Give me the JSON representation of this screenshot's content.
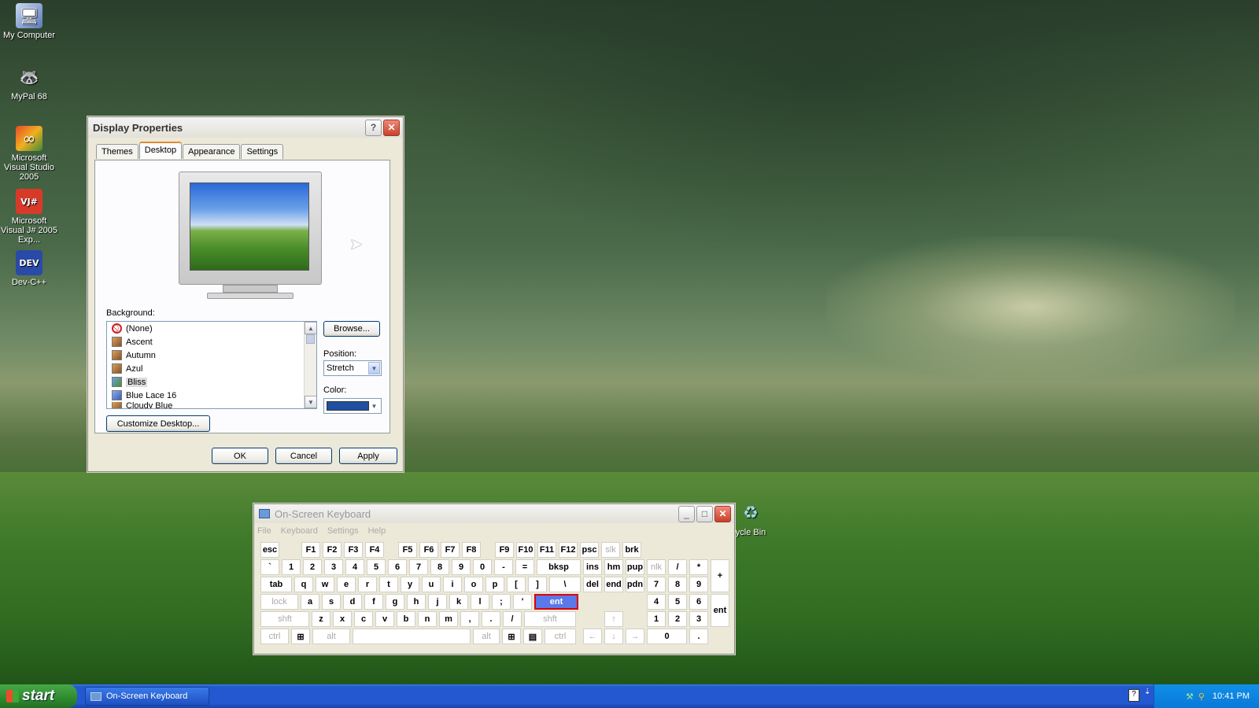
{
  "desktop": {
    "icons": [
      {
        "label": "My Computer",
        "glyph": "🖥"
      },
      {
        "label": "MyPal 68",
        "glyph": "🦝"
      },
      {
        "label": "Microsoft Visual Studio 2005",
        "glyph": "∞"
      },
      {
        "label": "Microsoft Visual J# 2005 Exp...",
        "glyph": "VJ#"
      },
      {
        "label": "Dev-C++",
        "glyph": "DEV"
      }
    ],
    "recycle_bin_label": "ycle Bin"
  },
  "display_properties": {
    "title": "Display Properties",
    "help_label": "?",
    "close_label": "✕",
    "tabs": [
      "Themes",
      "Desktop",
      "Appearance",
      "Settings"
    ],
    "active_tab": "Desktop",
    "background_label": "Background:",
    "backgrounds": [
      {
        "name": "(None)",
        "type": "none"
      },
      {
        "name": "Ascent",
        "type": "image"
      },
      {
        "name": "Autumn",
        "type": "image"
      },
      {
        "name": "Azul",
        "type": "image"
      },
      {
        "name": "Bliss",
        "type": "image",
        "selected": true
      },
      {
        "name": "Blue Lace 16",
        "type": "image"
      },
      {
        "name": "Cloudy Blue",
        "type": "image"
      }
    ],
    "browse_label": "Browse...",
    "position_label": "Position:",
    "position_value": "Stretch",
    "color_label": "Color:",
    "color_value": "#1f4ea3",
    "customize_label": "Customize Desktop...",
    "ok_label": "OK",
    "cancel_label": "Cancel",
    "apply_label": "Apply"
  },
  "osk": {
    "title": "On-Screen Keyboard",
    "menu": [
      "File",
      "Keyboard",
      "Settings",
      "Help"
    ],
    "highlighted_key": "ent"
  },
  "taskbar": {
    "start_label": "start",
    "task_label": "On-Screen Keyboard",
    "clock": "10:41 PM"
  }
}
